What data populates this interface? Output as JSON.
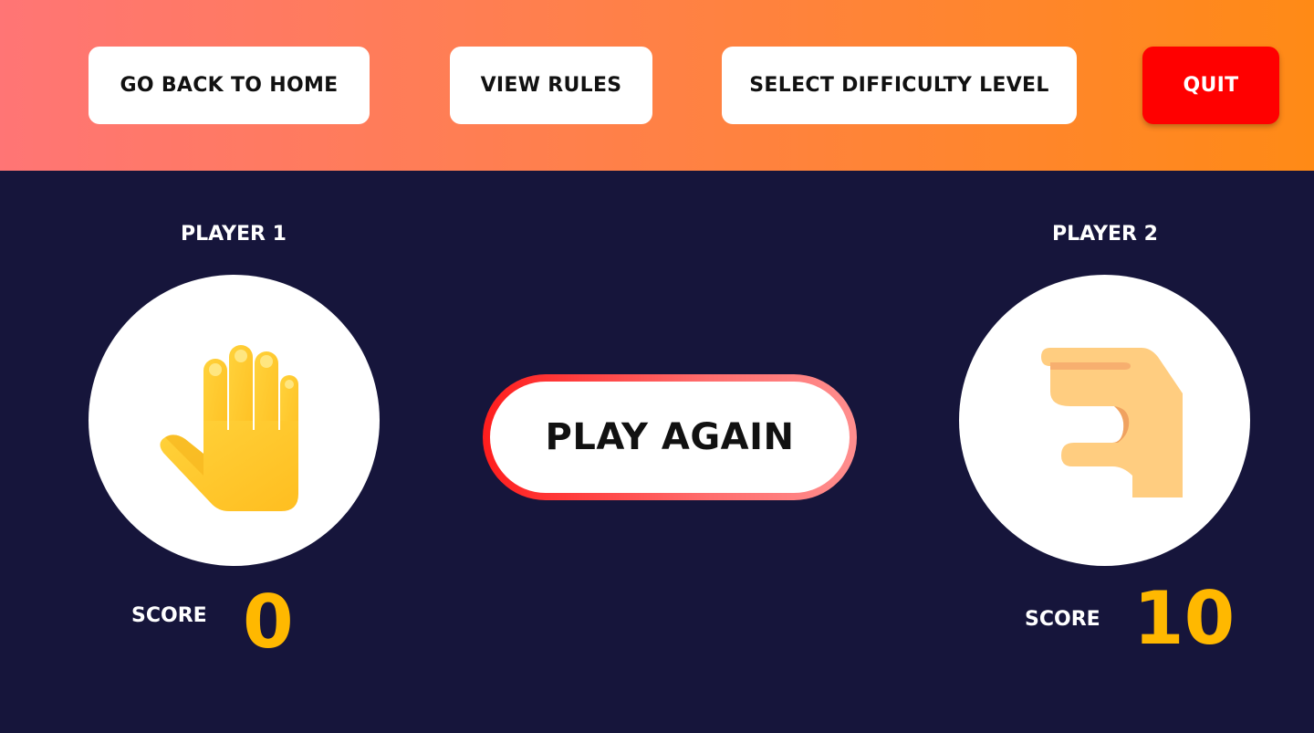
{
  "nav": {
    "home_label": "GO BACK TO HOME",
    "rules_label": "VIEW RULES",
    "difficulty_label": "SELECT DIFFICULTY LEVEL",
    "quit_label": "QUIT"
  },
  "players": [
    {
      "label": "PLAYER 1",
      "choice_icon": "paper-hand-icon",
      "score_label": "SCORE",
      "score": "0"
    },
    {
      "label": "PLAYER 2",
      "choice_icon": "scissors-hand-icon",
      "score_label": "SCORE",
      "score": "10"
    }
  ],
  "play_again_label": "PLAY AGAIN",
  "colors": {
    "background": "#16153b",
    "header_gradient_start": "#ff7575",
    "header_gradient_end": "#ff8a16",
    "quit": "#ff0000",
    "score": "#ffb800"
  }
}
